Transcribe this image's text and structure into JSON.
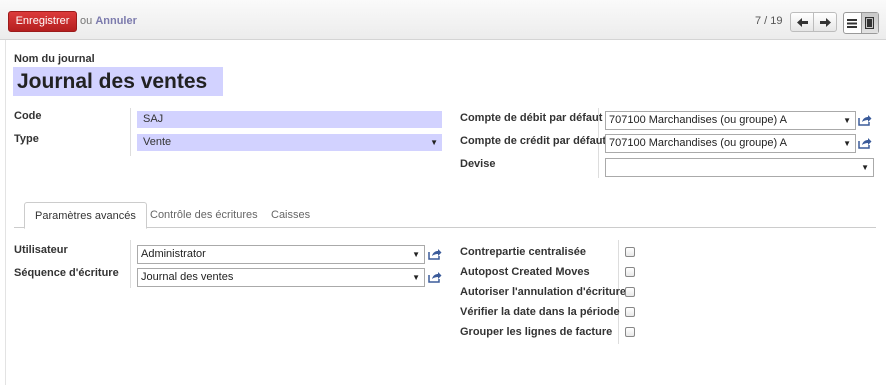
{
  "toolbar": {
    "save_label": "Enregistrer",
    "or_text": "ou",
    "cancel_label": "Annuler",
    "pager": "7 / 19"
  },
  "header": {
    "name_label": "Nom du journal",
    "name_value": "Journal des ventes"
  },
  "left_fields": {
    "code_label": "Code",
    "code_value": "SAJ",
    "type_label": "Type",
    "type_value": "Vente"
  },
  "right_fields": {
    "debit_label": "Compte de débit par défaut",
    "debit_value": "707100 Marchandises (ou groupe) A",
    "credit_label": "Compte de crédit par défaut",
    "credit_value": "707100 Marchandises (ou groupe) A",
    "currency_label": "Devise",
    "currency_value": ""
  },
  "tabs": [
    {
      "label": "Paramètres avancés"
    },
    {
      "label": "Contrôle des écritures"
    },
    {
      "label": "Caisses"
    }
  ],
  "advanced": {
    "user_label": "Utilisateur",
    "user_value": "Administrator",
    "sequence_label": "Séquence d'écriture",
    "sequence_value": "Journal des ventes"
  },
  "checkboxes": [
    {
      "label": "Contrepartie centralisée",
      "checked": false
    },
    {
      "label": "Autopost Created Moves",
      "checked": false
    },
    {
      "label": "Autoriser l'annulation d'écriture",
      "checked": false
    },
    {
      "label": "Vérifier la date dans la période",
      "checked": false
    },
    {
      "label": "Grouper les lignes de facture",
      "checked": false
    }
  ],
  "colors": {
    "save_button": "#c62a2a",
    "required_field": "#d2d2ff",
    "link": "#7c7bad"
  }
}
